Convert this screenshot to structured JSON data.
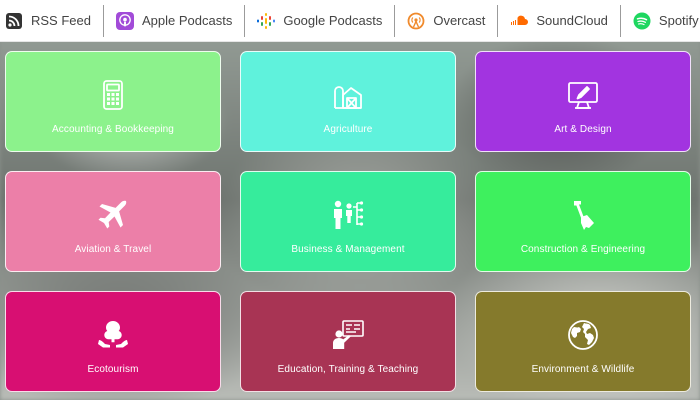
{
  "podcast_bar": {
    "items": [
      {
        "label": "RSS Feed",
        "icon": "rss-icon",
        "color": "#333333"
      },
      {
        "label": "Apple Podcasts",
        "icon": "apple-podcasts-icon",
        "color": "#a24bd8"
      },
      {
        "label": "Google Podcasts",
        "icon": "google-podcasts-icon",
        "color": "#4285f4"
      },
      {
        "label": "Overcast",
        "icon": "overcast-icon",
        "color": "#f08a2c"
      },
      {
        "label": "SoundCloud",
        "icon": "soundcloud-icon",
        "color": "#ff6a00"
      },
      {
        "label": "Spotify",
        "icon": "spotify-icon",
        "color": "#1ed760"
      }
    ]
  },
  "categories": [
    {
      "label": "Accounting & Bookkeeping",
      "icon": "calculator-icon",
      "color": "#8cf28c"
    },
    {
      "label": "Agriculture",
      "icon": "barn-icon",
      "color": "#5ff2dc"
    },
    {
      "label": "Art & Design",
      "icon": "monitor-icon",
      "color": "#a234e0"
    },
    {
      "label": "Aviation & Travel",
      "icon": "airplane-icon",
      "color": "#ec7fa8"
    },
    {
      "label": "Business & Management",
      "icon": "org-chart-icon",
      "color": "#36ec9c"
    },
    {
      "label": "Construction & Engineering",
      "icon": "shovel-icon",
      "color": "#3ef05e"
    },
    {
      "label": "Ecotourism",
      "icon": "tree-hands-icon",
      "color": "#d80f72"
    },
    {
      "label": "Education, Training & Teaching",
      "icon": "teacher-board-icon",
      "color": "#a83454"
    },
    {
      "label": "Environment & Wildlife",
      "icon": "globe-icon",
      "color": "#857a2c"
    }
  ]
}
